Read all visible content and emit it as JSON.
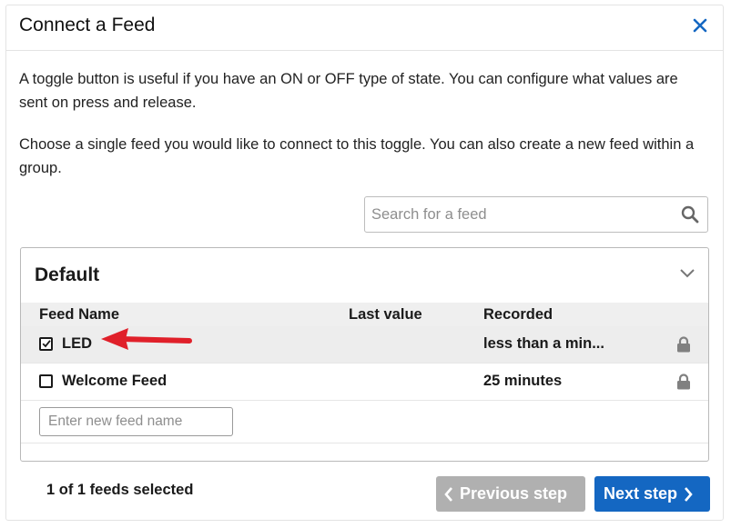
{
  "dialog": {
    "title": "Connect a Feed",
    "close_icon": "close-icon"
  },
  "intro": {
    "paragraph1": "A toggle button is useful if you have an ON or OFF type of state. You can configure what values are sent on press and release.",
    "paragraph2": "Choose a single feed you would like to connect to this toggle. You can also create a new feed within a group."
  },
  "search": {
    "placeholder": "Search for a feed",
    "value": "",
    "icon": "search-icon"
  },
  "group": {
    "name": "Default",
    "columns": {
      "feed_name": "Feed Name",
      "last_value": "Last value",
      "recorded": "Recorded"
    },
    "feeds": [
      {
        "name": "LED",
        "last_value": "",
        "recorded": "less than a min...",
        "checked": true,
        "icon": "lock-icon"
      },
      {
        "name": "Welcome Feed",
        "last_value": "",
        "recorded": "25 minutes",
        "checked": false,
        "icon": "lock-icon"
      }
    ],
    "new_feed_placeholder": "Enter new feed name"
  },
  "annotation": {
    "color": "#e0202a"
  },
  "footer": {
    "status": "1 of 1 feeds selected",
    "prev_label": "Previous step",
    "next_label": "Next step"
  },
  "colors": {
    "primary": "#1467c2",
    "disabled": "#b0b0b0",
    "close": "#1467c2"
  }
}
